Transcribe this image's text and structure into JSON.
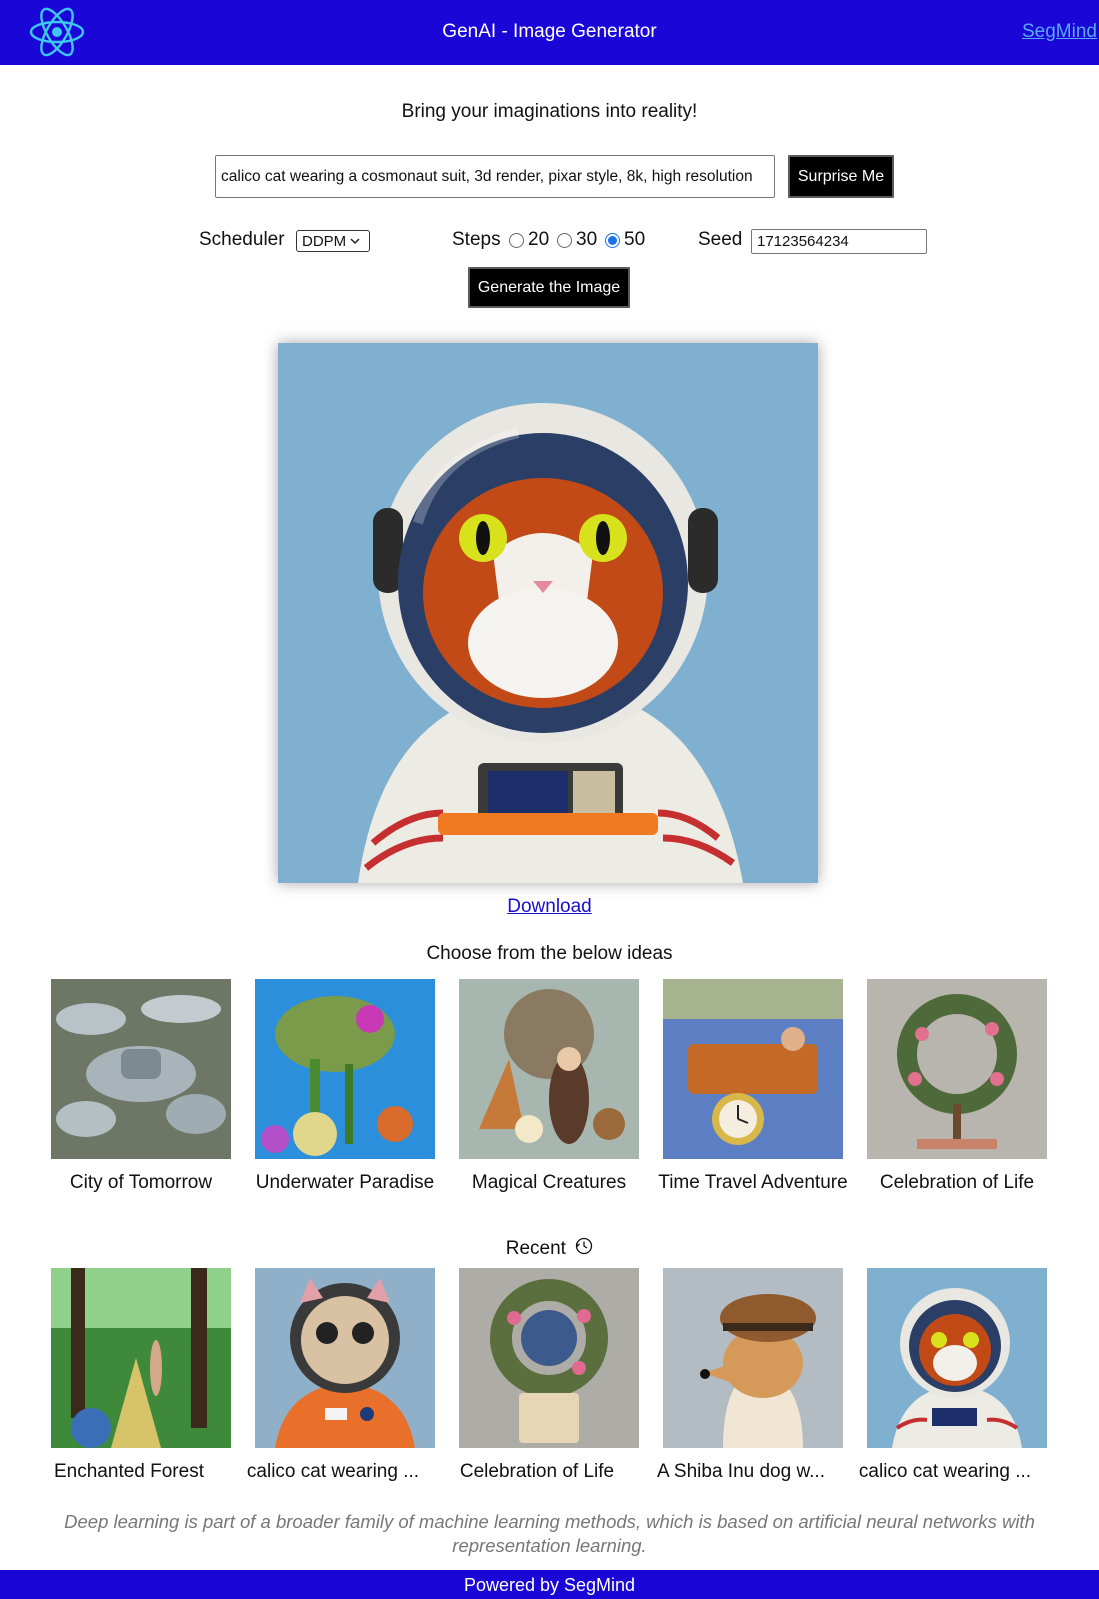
{
  "header": {
    "logo_icon": "react-atom-icon",
    "title": "GenAI - Image Generator",
    "link": "SegMind",
    "bg_color": "#1a06d6"
  },
  "tagline": "Bring your imaginations into reality!",
  "prompt": {
    "value": "calico cat wearing a cosmonaut suit, 3d render, pixar style, 8k, high resolution",
    "surprise_label": "Surprise Me"
  },
  "controls": {
    "scheduler_label": "Scheduler",
    "scheduler_value": "DDPM",
    "steps_label": "Steps",
    "steps_options": [
      "20",
      "30",
      "50"
    ],
    "steps_selected": "50",
    "seed_label": "Seed",
    "seed_value": "17123564234"
  },
  "generate_label": "Generate the Image",
  "download_label": "Download",
  "ideas": {
    "title": "Choose from the below ideas",
    "items": [
      {
        "label": "City of Tomorrow"
      },
      {
        "label": "Underwater Paradise"
      },
      {
        "label": "Magical Creatures"
      },
      {
        "label": "Time Travel Adventure"
      },
      {
        "label": "Celebration of Life"
      }
    ]
  },
  "recent": {
    "title": "Recent",
    "icon": "history-clock-icon",
    "items": [
      {
        "label": "Enchanted Forest"
      },
      {
        "label": "calico cat wearing ..."
      },
      {
        "label": "Celebration of Life"
      },
      {
        "label": "A Shiba Inu dog w..."
      },
      {
        "label": "calico cat wearing ..."
      }
    ]
  },
  "footer": {
    "text": "Deep learning is part of a broader family of machine learning methods, which is based on artificial neural networks with representation learning.",
    "powered_by": "Powered by SegMind"
  }
}
